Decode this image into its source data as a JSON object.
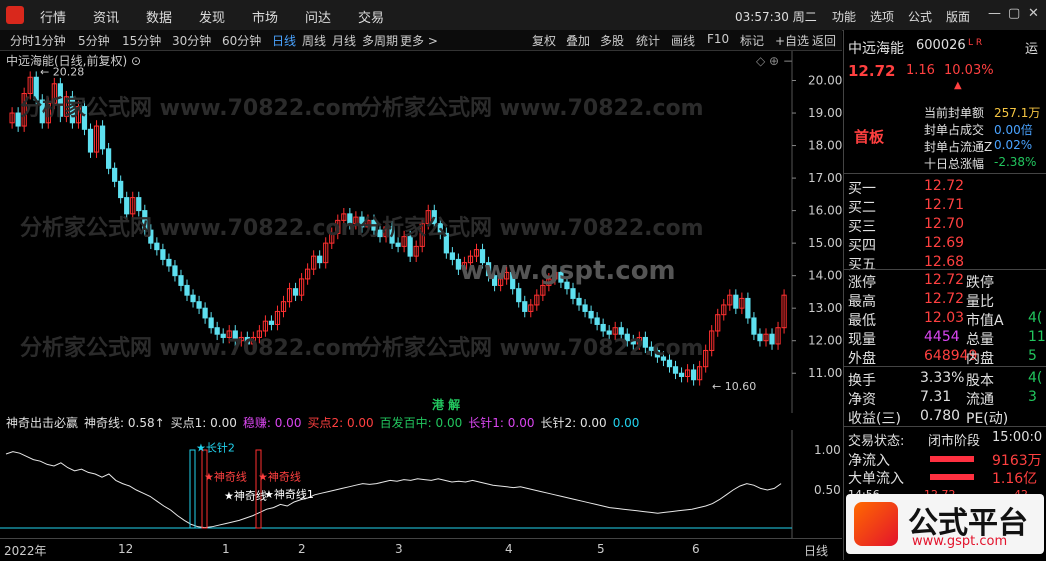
{
  "menu": [
    "行情",
    "资讯",
    "数据",
    "发现",
    "市场",
    "问达",
    "交易"
  ],
  "clock": "03:57:30 周二",
  "right_menu": [
    "功能",
    "选项",
    "公式",
    "版面"
  ],
  "periods": [
    "分时",
    "1分钟",
    "5分钟",
    "15分钟",
    "30分钟",
    "60分钟",
    "日线",
    "周线",
    "月线",
    "多周期",
    "更多 >"
  ],
  "active_period": "日线",
  "tools": [
    "复权",
    "叠加",
    "多股",
    "统计",
    "画线",
    "F10",
    "标记",
    "+自选",
    "返回"
  ],
  "chart_title": "中远海能(日线,前复权)",
  "watermark": "分析家公式网 www.70822.com",
  "center_watermark": "www.gspt.com",
  "high_label": "20.28",
  "low_label": "10.60",
  "y_labels": [
    "20.00",
    "19.00",
    "18.00",
    "17.00",
    "16.00",
    "15.00",
    "14.00",
    "13.00",
    "12.00",
    "11.00"
  ],
  "ind_y_labels": [
    "1.00",
    "0.50"
  ],
  "toggle_label": "港 解",
  "indicator": {
    "name": "神奇出击必赢",
    "items": [
      {
        "text": "神奇线: 0.58↑",
        "color": "#e0e0e0"
      },
      {
        "text": "买点1: 0.00",
        "color": "#e0e0e0"
      },
      {
        "text": "稳赚: 0.00",
        "color": "#d946ef"
      },
      {
        "text": "买点2: 0.00",
        "color": "#ff4040"
      },
      {
        "text": "百发百中: 0.00",
        "color": "#22c55e"
      },
      {
        "text": "长针1: 0.00",
        "color": "#d946ef"
      },
      {
        "text": "长针2: 0.00",
        "color": "#e0e0e0"
      },
      {
        "text": "0.00",
        "color": "#22d3ee"
      }
    ]
  },
  "signals": [
    "长针2",
    "神奇线",
    "神奇线",
    "神奇线",
    "神奇线1"
  ],
  "x_labels": [
    "2022年",
    "12",
    "1",
    "2",
    "3",
    "4",
    "5",
    "6"
  ],
  "x_label_period": "日线",
  "stock": {
    "name": "中远海能",
    "code": "600026",
    "tag": "L R",
    "extra": "运",
    "price": "12.72",
    "change": "1.16",
    "pct": "10.03%",
    "board": "首板",
    "seal_rows": [
      {
        "label": "当前封单额",
        "value": "257.1万",
        "color": "#f5c542"
      },
      {
        "label": "封单占成交",
        "value": "0.00倍",
        "color": "#4aa3ff"
      },
      {
        "label": "封单占流通Z",
        "value": "0.02%",
        "color": "#4aa3ff"
      },
      {
        "label": "十日总涨幅",
        "value": "-2.38%",
        "color": "#22c55e"
      }
    ],
    "bids": [
      {
        "label": "买一",
        "price": "12.72"
      },
      {
        "label": "买二",
        "price": "12.71"
      },
      {
        "label": "买三",
        "price": "12.70"
      },
      {
        "label": "买四",
        "price": "12.69"
      },
      {
        "label": "买五",
        "price": "12.68"
      }
    ],
    "quote": [
      {
        "l": "涨停",
        "v": "12.72",
        "vc": "#ff4040",
        "l2": "跌停",
        "v2": ""
      },
      {
        "l": "最高",
        "v": "12.72",
        "vc": "#ff4040",
        "l2": "量比",
        "v2": ""
      },
      {
        "l": "最低",
        "v": "12.03",
        "vc": "#ff4040",
        "l2": "市值A",
        "v2": "4("
      },
      {
        "l": "现量",
        "v": "4454",
        "vc": "#d946ef",
        "l2": "总量",
        "v2": "11"
      },
      {
        "l": "外盘",
        "v": "648949",
        "vc": "#ff4040",
        "l2": "内盘",
        "v2": "5"
      }
    ],
    "quote2": [
      {
        "l": "换手",
        "v": "3.33%",
        "l2": "股本",
        "v2": "4("
      },
      {
        "l": "净资",
        "v": "7.31",
        "l2": "流通",
        "v2": "3"
      },
      {
        "l": "收益(三)",
        "v": "0.780",
        "l2": "PE(动)",
        "v2": ""
      }
    ],
    "trade_status_label": "交易状态:",
    "trade_status": "闭市阶段",
    "trade_time": "15:00:0",
    "net_inflow_label": "净流入",
    "net_inflow": "9163万",
    "big_inflow_label": "大单流入",
    "big_inflow": "1.16亿",
    "last_row": [
      "14:56",
      "12.72",
      "42"
    ]
  },
  "brand": {
    "name": "公式平台",
    "url": "www.gspt.com"
  },
  "chart_data": {
    "type": "candlestick",
    "title": "中远海能(日线,前复权)",
    "y_range": [
      10.3,
      20.6
    ],
    "closes": [
      19.0,
      18.6,
      19.6,
      20.1,
      19.4,
      18.7,
      19.3,
      19.9,
      18.9,
      19.5,
      18.7,
      19.2,
      18.5,
      17.8,
      18.6,
      17.9,
      17.3,
      16.9,
      16.4,
      15.9,
      16.4,
      16.0,
      15.4,
      15.0,
      14.8,
      14.5,
      14.3,
      14.0,
      13.7,
      13.4,
      13.2,
      13.0,
      12.7,
      12.4,
      12.2,
      12.1,
      12.3,
      12.0,
      12.1,
      11.9,
      12.1,
      12.3,
      12.6,
      12.5,
      12.9,
      13.2,
      13.6,
      13.4,
      13.9,
      14.2,
      14.6,
      14.4,
      15.0,
      15.3,
      15.7,
      15.9,
      15.6,
      15.8,
      15.5,
      15.7,
      15.4,
      15.2,
      15.5,
      15.0,
      14.9,
      15.2,
      14.6,
      14.9,
      15.6,
      16.0,
      15.6,
      15.3,
      14.7,
      14.5,
      14.2,
      14.4,
      14.6,
      14.8,
      14.4,
      14.0,
      13.7,
      13.9,
      14.1,
      13.6,
      13.2,
      12.9,
      13.1,
      13.4,
      13.7,
      13.9,
      14.1,
      13.8,
      13.6,
      13.3,
      13.1,
      12.9,
      12.7,
      12.5,
      12.3,
      12.2,
      12.4,
      12.2,
      12.0,
      11.9,
      12.1,
      11.8,
      11.7,
      11.5,
      11.4,
      11.2,
      11.0,
      10.9,
      11.1,
      10.8,
      11.2,
      11.7,
      12.3,
      12.8,
      13.1,
      13.4,
      13.0,
      13.3,
      12.7,
      12.2,
      12.0,
      12.2,
      11.9,
      12.4,
      13.4
    ],
    "indicator_values": [
      0.95,
      0.98,
      0.96,
      0.92,
      0.88,
      0.86,
      0.82,
      0.8,
      0.84,
      0.78,
      0.74,
      0.76,
      0.72,
      0.7,
      0.66,
      0.7,
      0.62,
      0.58,
      0.55,
      0.5,
      0.46,
      0.42,
      0.36,
      0.3,
      0.25,
      0.18,
      0.12,
      0.07,
      0.04,
      0.03,
      0.04,
      0.06,
      0.08,
      0.1,
      0.12,
      0.15,
      0.18,
      0.22,
      0.26,
      0.28,
      0.32,
      0.3,
      0.35,
      0.38,
      0.4,
      0.44,
      0.46,
      0.48,
      0.5,
      0.52,
      0.54,
      0.56,
      0.58,
      0.57,
      0.58,
      0.6,
      0.62,
      0.61,
      0.63,
      0.62,
      0.64,
      0.63,
      0.62,
      0.64,
      0.62,
      0.6,
      0.61,
      0.6,
      0.62,
      0.6,
      0.58,
      0.56,
      0.55,
      0.54,
      0.53,
      0.54,
      0.52,
      0.5,
      0.48,
      0.46,
      0.44,
      0.42,
      0.4,
      0.38,
      0.36,
      0.34,
      0.32,
      0.3,
      0.28,
      0.27,
      0.26,
      0.25,
      0.24,
      0.23,
      0.22,
      0.21,
      0.22,
      0.23,
      0.24,
      0.25,
      0.26,
      0.28,
      0.3,
      0.33,
      0.38,
      0.44,
      0.5,
      0.55,
      0.58,
      0.56,
      0.52,
      0.5,
      0.52,
      0.58
    ],
    "indicator_range": [
      0,
      1.2
    ]
  }
}
